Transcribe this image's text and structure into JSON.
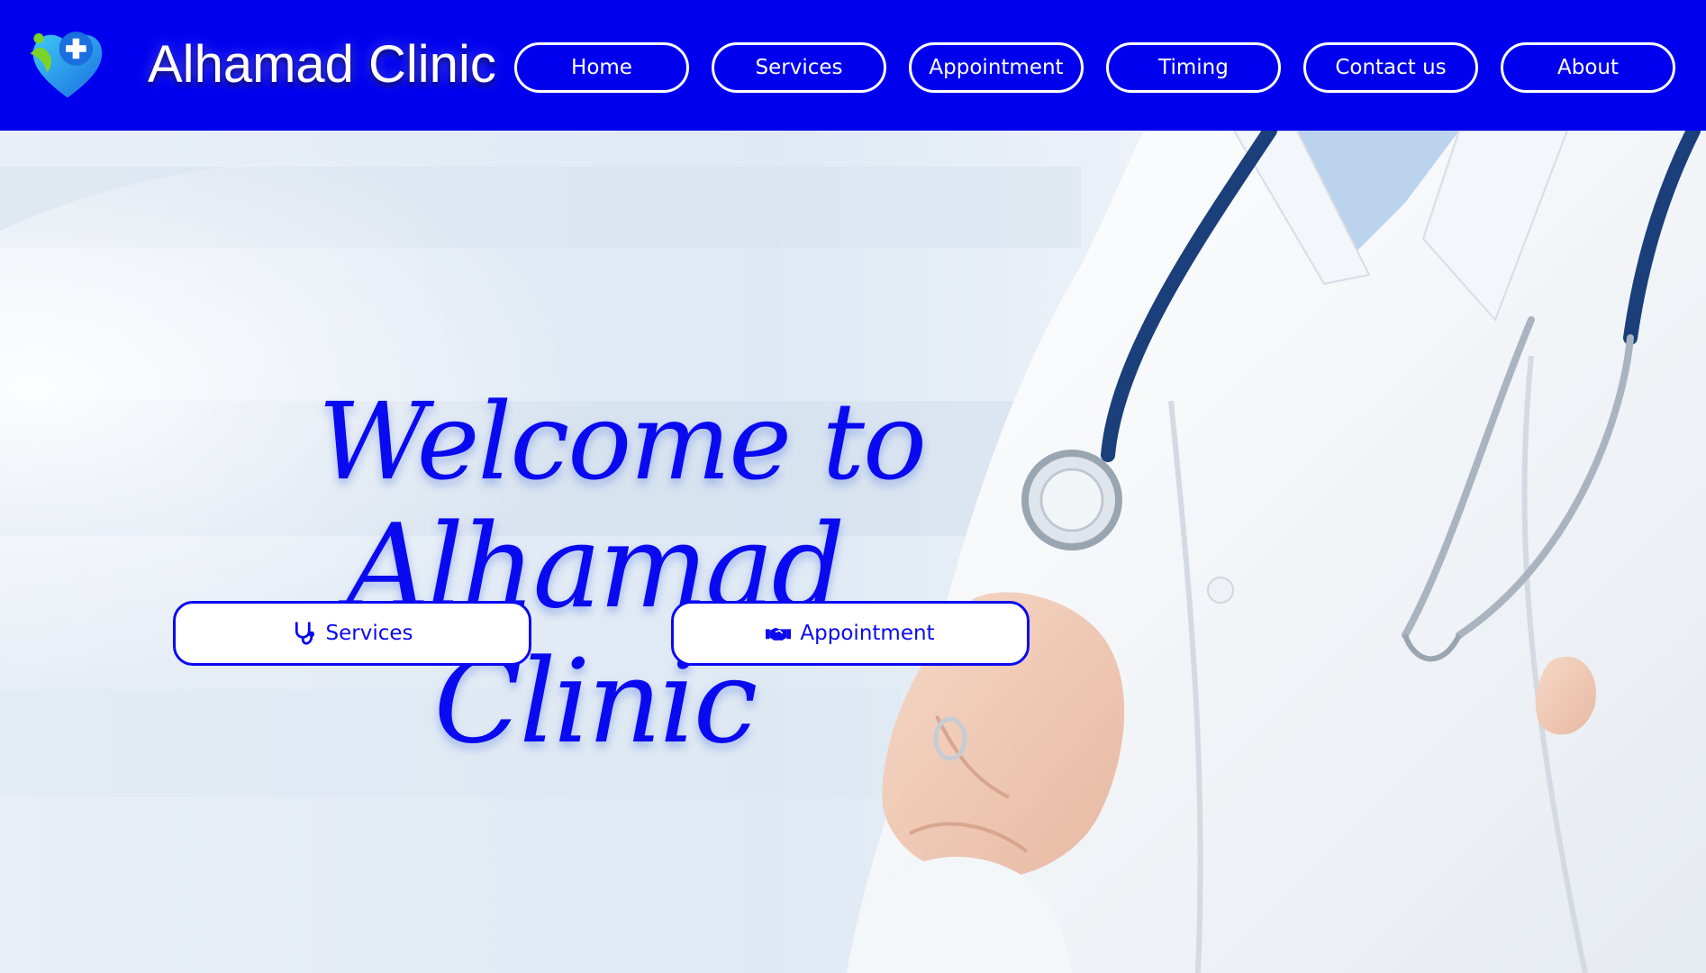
{
  "header": {
    "brand": "Alhamad Clinic",
    "logo_icon": "heart-plus-person-icon",
    "background_color": "#0000ee",
    "nav": [
      {
        "label": "Home"
      },
      {
        "label": "Services"
      },
      {
        "label": "Appointment"
      },
      {
        "label": "Timing"
      },
      {
        "label": "Contact us"
      },
      {
        "label": "About"
      }
    ]
  },
  "hero": {
    "welcome_line1": "Welcome to",
    "welcome_line2": "Alhamad Clinic",
    "accent_color": "#0a0af0",
    "buttons": [
      {
        "label": "Services",
        "icon": "stethoscope-icon"
      },
      {
        "label": "Appointment",
        "icon": "handshake-icon"
      }
    ]
  }
}
